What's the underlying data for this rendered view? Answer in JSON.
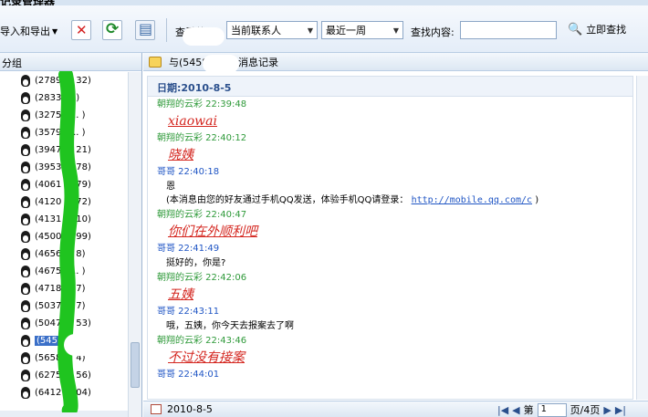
{
  "window": {
    "title": "记录管理器"
  },
  "toolbar": {
    "import_export_label": "导入和导出",
    "range_label": "查看范围:",
    "contact_select_value": "当前联系人",
    "period_select_value": "最近一周",
    "search_label": "查找内容:",
    "search_value": "",
    "find_label": "立即查找"
  },
  "left_panel": {
    "header": "分组",
    "contacts": [
      {
        "label": "(2789 ... 32)"
      },
      {
        "label": "(2833 ... )"
      },
      {
        "label": "(32752 ... )"
      },
      {
        "label": "(35793 ... )"
      },
      {
        "label": "(3947 ... 21)"
      },
      {
        "label": "(3953 ... 78)"
      },
      {
        "label": "(4061 ... 79)"
      },
      {
        "label": "(4120 ... 72)"
      },
      {
        "label": "(4131 ... 10)"
      },
      {
        "label": "(4500 ... 99)"
      },
      {
        "label": "(4656 ... 8)"
      },
      {
        "label": "(46750 ... )"
      },
      {
        "label": "(4718 ... 7)"
      },
      {
        "label": "(5037 ... 7)"
      },
      {
        "label": "(5047 ... 53)"
      },
      {
        "label": "(545 ... )",
        "selected": true
      },
      {
        "label": "(5658 ... 4)"
      },
      {
        "label": "(6275 ... 56)"
      },
      {
        "label": "(6412 ... 04)"
      }
    ]
  },
  "right_panel": {
    "header": "与(5458 ... )的消息记录",
    "date_header": "日期:2010-8-5",
    "messages": [
      {
        "sender": "朝翔的云彩 22:39:48",
        "style": "green",
        "text": "xiaowai",
        "kind": "red"
      },
      {
        "sender": "朝翔的云彩 22:40:12",
        "style": "green",
        "text": "晓姨",
        "kind": "red"
      },
      {
        "sender": "哥哥 22:40:18",
        "style": "blue",
        "text": "恩",
        "kind": "plain",
        "note": "(本消息由您的好友通过手机QQ发送，体验手机QQ请登录： ",
        "link": "http://mobile.qq.com/c",
        "note_end": " )"
      },
      {
        "sender": "朝翔的云彩 22:40:47",
        "style": "green",
        "text": "你们在外顺利吧",
        "kind": "red"
      },
      {
        "sender": "哥哥 22:41:49",
        "style": "blue",
        "text": "挺好的，你是?",
        "kind": "plain"
      },
      {
        "sender": "朝翔的云彩 22:42:06",
        "style": "green",
        "text": "五姨",
        "kind": "red"
      },
      {
        "sender": "哥哥 22:43:11",
        "style": "blue",
        "text": "哦，五姨，你今天去报案去了啊",
        "kind": "plain"
      },
      {
        "sender": "朝翔的云彩 22:43:46",
        "style": "green",
        "text": "不过没有接案",
        "kind": "red"
      },
      {
        "sender": "哥哥 22:44:01",
        "style": "blue",
        "text": "",
        "kind": "plain"
      }
    ]
  },
  "bottom_bar": {
    "date": "2010-8-5",
    "page_prefix": "第",
    "page_value": "1",
    "page_suffix": "页/4页"
  }
}
